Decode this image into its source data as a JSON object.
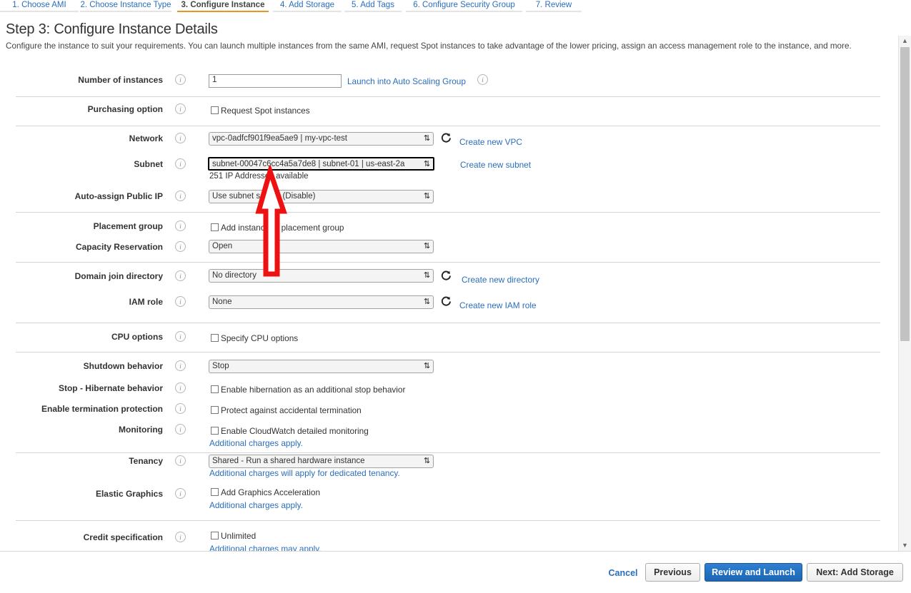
{
  "wizard": {
    "tabs": [
      {
        "label": "1. Choose AMI",
        "active": false
      },
      {
        "label": "2. Choose Instance Type",
        "active": false
      },
      {
        "label": "3. Configure Instance",
        "active": true
      },
      {
        "label": "4. Add Storage",
        "active": false
      },
      {
        "label": "5. Add Tags",
        "active": false
      },
      {
        "label": "6. Configure Security Group",
        "active": false
      },
      {
        "label": "7. Review",
        "active": false
      }
    ]
  },
  "page": {
    "title": "Step 3: Configure Instance Details",
    "description": "Configure the instance to suit your requirements. You can launch multiple instances from the same AMI, request Spot instances to take advantage of the lower pricing, assign an access management role to the instance, and more."
  },
  "form": {
    "number_of_instances": {
      "label": "Number of instances",
      "value": "1",
      "link": "Launch into Auto Scaling Group"
    },
    "purchasing_option": {
      "label": "Purchasing option",
      "checkbox": "Request Spot instances",
      "checked": false
    },
    "network": {
      "label": "Network",
      "value": "vpc-0adfcf901f9ea5ae9 | my-vpc-test",
      "link": "Create new VPC"
    },
    "subnet": {
      "label": "Subnet",
      "value": "subnet-00047c6cc4a5a7de8 | subnet-01 | us-east-2a",
      "note": "251 IP Addresses available",
      "link": "Create new subnet",
      "focused": true
    },
    "auto_assign_public_ip": {
      "label": "Auto-assign Public IP",
      "value": "Use subnet setting (Disable)"
    },
    "placement_group": {
      "label": "Placement group",
      "checkbox": "Add instance to placement group",
      "checked": false
    },
    "capacity_reservation": {
      "label": "Capacity Reservation",
      "value": "Open"
    },
    "domain_join_directory": {
      "label": "Domain join directory",
      "value": "No directory",
      "link": "Create new directory"
    },
    "iam_role": {
      "label": "IAM role",
      "value": "None",
      "link": "Create new IAM role"
    },
    "cpu_options": {
      "label": "CPU options",
      "checkbox": "Specify CPU options",
      "checked": false
    },
    "shutdown_behavior": {
      "label": "Shutdown behavior",
      "value": "Stop"
    },
    "hibernate_behavior": {
      "label": "Stop - Hibernate behavior",
      "checkbox": "Enable hibernation as an additional stop behavior",
      "checked": false
    },
    "termination_protection": {
      "label": "Enable termination protection",
      "checkbox": "Protect against accidental termination",
      "checked": false
    },
    "monitoring": {
      "label": "Monitoring",
      "checkbox": "Enable CloudWatch detailed monitoring",
      "checked": false,
      "link": "Additional charges apply."
    },
    "tenancy": {
      "label": "Tenancy",
      "value": "Shared - Run a shared hardware instance",
      "link": "Additional charges will apply for dedicated tenancy."
    },
    "elastic_graphics": {
      "label": "Elastic Graphics",
      "checkbox": "Add Graphics Acceleration",
      "checked": false,
      "link": "Additional charges apply."
    },
    "credit_specification": {
      "label": "Credit specification",
      "checkbox": "Unlimited",
      "checked": false,
      "link": "Additional charges may apply."
    }
  },
  "footer": {
    "cancel": "Cancel",
    "previous": "Previous",
    "review_and_launch": "Review and Launch",
    "next": "Next: Add Storage"
  },
  "colors": {
    "accent_blue": "#2a6ebb",
    "active_tab_underline": "#ec912d",
    "primary_button": "#1c66b5",
    "annotation": "#ee1111"
  },
  "icons": {
    "info": "i",
    "dropdown": "⇅",
    "scroll_up": "▲",
    "scroll_down": "▼"
  }
}
